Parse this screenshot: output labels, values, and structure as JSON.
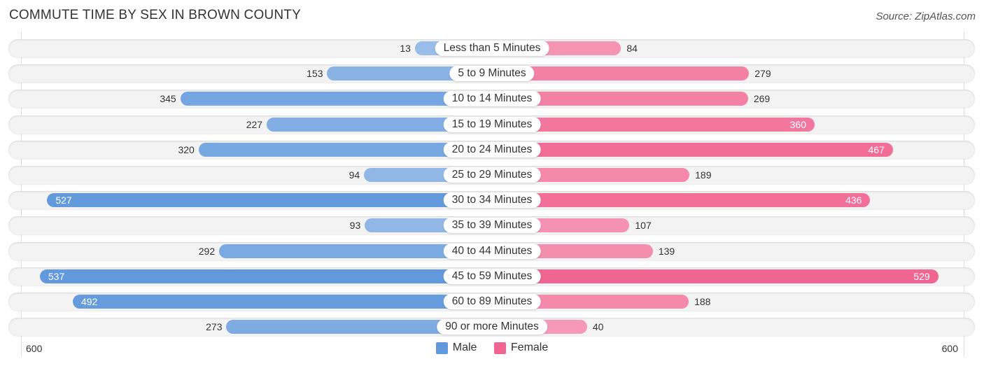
{
  "chart_data": {
    "type": "bar",
    "orientation": "horizontal-diverging",
    "title": "COMMUTE TIME BY SEX IN BROWN COUNTY",
    "source": "Source: ZipAtlas.com",
    "categories": [
      "Less than 5 Minutes",
      "5 to 9 Minutes",
      "10 to 14 Minutes",
      "15 to 19 Minutes",
      "20 to 24 Minutes",
      "25 to 29 Minutes",
      "30 to 34 Minutes",
      "35 to 39 Minutes",
      "40 to 44 Minutes",
      "45 to 59 Minutes",
      "60 to 89 Minutes",
      "90 or more Minutes"
    ],
    "series": [
      {
        "name": "Male",
        "color": "#6199dc",
        "values": [
          13,
          153,
          345,
          227,
          320,
          94,
          527,
          93,
          292,
          537,
          492,
          273
        ]
      },
      {
        "name": "Female",
        "color": "#f06591",
        "values": [
          84,
          279,
          269,
          360,
          467,
          189,
          436,
          107,
          139,
          529,
          188,
          40
        ]
      }
    ],
    "axis": {
      "left_label": "600",
      "right_label": "600",
      "max": 600
    },
    "legend": {
      "position": "bottom-center",
      "items": [
        "Male",
        "Female"
      ]
    }
  }
}
